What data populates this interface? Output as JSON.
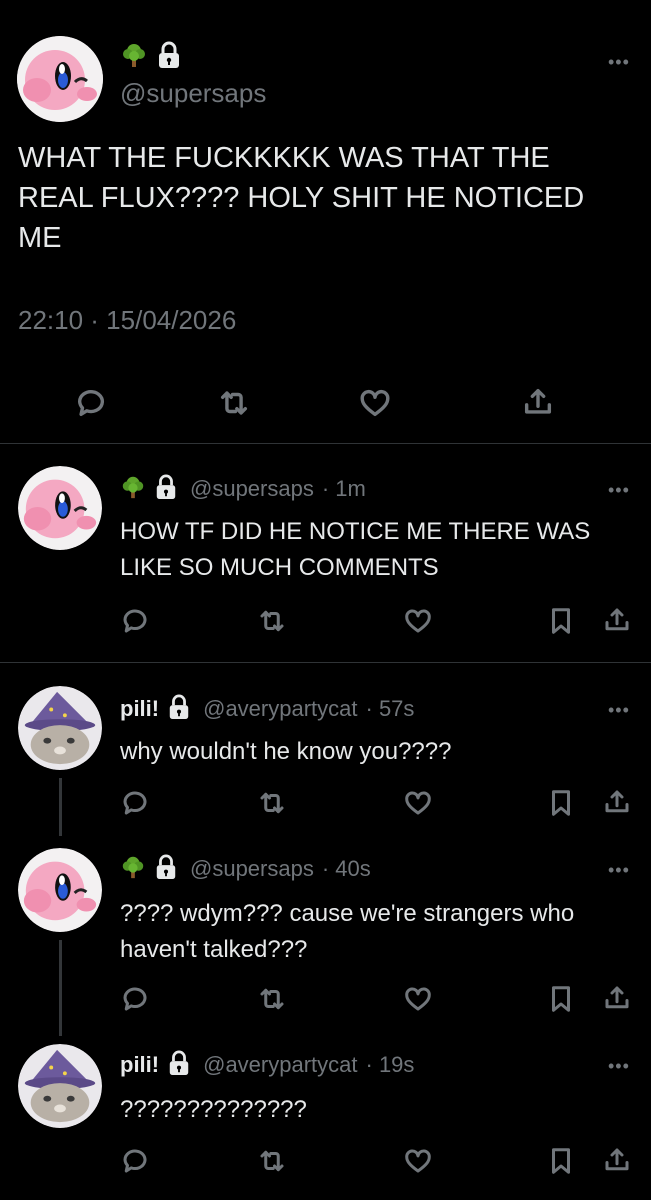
{
  "main_tweet": {
    "handle": "@supersaps",
    "text_line1": "WHAT THE FUCKKKKK WAS THAT THE",
    "text_line2": "REAL FLUX???? HOLY SHIT HE NOTICED",
    "text_line3": "ME",
    "timestamp": "22:10 · 15/04/2026",
    "badge_icons": [
      "tree-emoji-icon",
      "lock-icon"
    ]
  },
  "replies": [
    {
      "handle": "@supersaps",
      "time": "· 1m",
      "text_line1": "HOW TF DID HE NOTICE ME THERE WAS",
      "text_line2": "LIKE SO MUCH COMMENTS"
    },
    {
      "name": "pili!",
      "handle": "@averypartycat",
      "time": "· 57s",
      "text_line1": "why wouldn't he know you????"
    },
    {
      "handle": "@supersaps",
      "time": "· 40s",
      "text_line1": "???? wdym??? cause we're strangers who",
      "text_line2": "haven't talked???"
    },
    {
      "name": "pili!",
      "handle": "@averypartycat",
      "time": "· 19s",
      "text_line1": "??????????????"
    }
  ],
  "more_label": "•••",
  "colors": {
    "background": "#000000",
    "text": "#e7e9ea",
    "secondary": "#71767b",
    "divider": "#2f3336"
  }
}
